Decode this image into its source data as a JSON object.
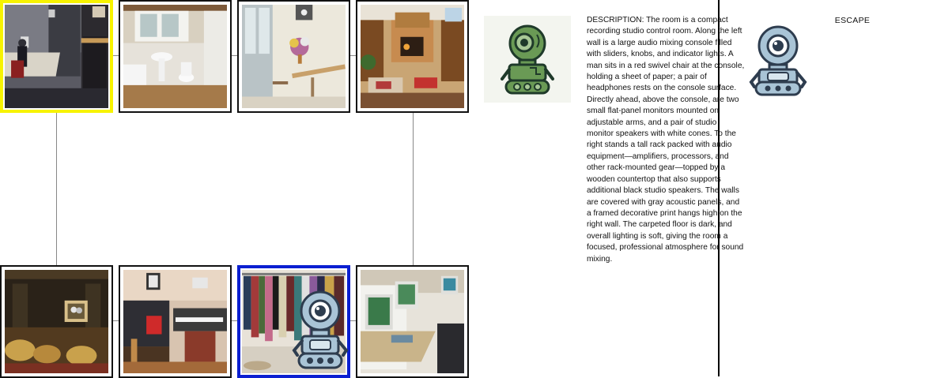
{
  "board": {
    "rooms": [
      {
        "id": "recording-studio",
        "state": "current",
        "scene": "studio"
      },
      {
        "id": "bathroom",
        "state": "normal",
        "scene": "bathroom"
      },
      {
        "id": "hallway-flowers",
        "state": "normal",
        "scene": "hall"
      },
      {
        "id": "living-room",
        "state": "normal",
        "scene": "living"
      },
      {
        "id": "home-theater",
        "state": "normal",
        "scene": "theater"
      },
      {
        "id": "music-room",
        "state": "normal",
        "scene": "music"
      },
      {
        "id": "closet",
        "state": "target",
        "scene": "closet"
      },
      {
        "id": "computer-lab",
        "state": "normal",
        "scene": "lab"
      }
    ],
    "highlight_colors": {
      "current": "#f7f300",
      "target": "#0b1fd1"
    }
  },
  "player": {
    "icon": "green-robot-icon",
    "color": "#6a9a55"
  },
  "agent": {
    "icon": "blue-robot-icon",
    "color": "#a9c4d6"
  },
  "description": "DESCRIPTION: The room is a compact recording studio control room. Along the left wall is a large audio mixing console filled with sliders, knobs, and indicator lights. A man sits in a red swivel chair at the console, holding a sheet of paper; a pair of headphones rests on the console surface. Directly ahead, above the console, are two small flat-panel monitors mounted on adjustable arms, and a pair of studio monitor speakers with white cones. To the right stands a tall rack packed with audio equipment—amplifiers, processors, and other rack-mounted gear—topped by a wooden countertop that also supports additional black studio speakers. The walls are covered with gray acoustic panels, and a framed decorative print hangs high on the right wall. The carpeted floor is dark, and overall lighting is soft, giving the room a focused, professional atmosphere for sound mixing.",
  "escape_label": "ESCAPE"
}
